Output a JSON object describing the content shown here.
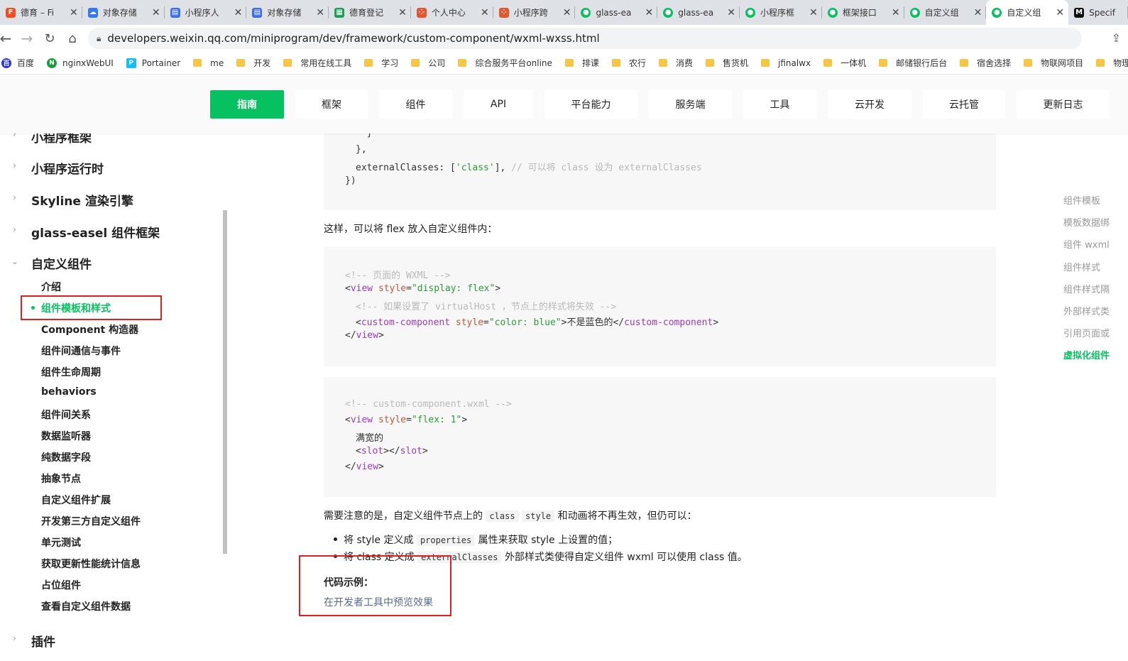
{
  "browser": {
    "tabs": [
      {
        "label": "德育 – Fi",
        "icon": "figma-icon",
        "color": "#f24e1e"
      },
      {
        "label": "对象存储",
        "icon": "cloud-icon",
        "color": "#3478f6"
      },
      {
        "label": "小程序人",
        "icon": "doc-icon",
        "color": "#3d6ee6"
      },
      {
        "label": "对象存储",
        "icon": "doc-icon",
        "color": "#3d6ee6"
      },
      {
        "label": "德育登记",
        "icon": "sheet-icon",
        "color": "#1e9e57"
      },
      {
        "label": "个人中心",
        "icon": "grid-icon",
        "color": "#e4572e"
      },
      {
        "label": "小程序跨",
        "icon": "grid-icon",
        "color": "#e4572e"
      },
      {
        "label": "glass-ea",
        "icon": "wechat-icon",
        "color": "#07c160"
      },
      {
        "label": "glass-ea",
        "icon": "wechat-icon",
        "color": "#07c160"
      },
      {
        "label": "小程序框",
        "icon": "wechat-icon",
        "color": "#07c160"
      },
      {
        "label": "框架接口",
        "icon": "wechat-icon",
        "color": "#07c160"
      },
      {
        "label": "自定义组",
        "icon": "wechat-icon",
        "color": "#07c160"
      },
      {
        "label": "自定义组",
        "icon": "wechat-icon",
        "color": "#07c160"
      },
      {
        "label": "Specif",
        "icon": "m-icon",
        "color": "#111111"
      }
    ],
    "url": "developers.weixin.qq.com/miniprogram/dev/framework/custom-component/wxml-wxss.html",
    "bookmarks": [
      {
        "label": "百度",
        "type": "icon",
        "color": "#2932e1"
      },
      {
        "label": "nginxWebUI",
        "type": "icon",
        "color": "#1a9e3c"
      },
      {
        "label": "Portainer",
        "type": "icon",
        "color": "#13bef9"
      },
      {
        "label": "me",
        "type": "folder"
      },
      {
        "label": "开发",
        "type": "folder"
      },
      {
        "label": "常用在线工具",
        "type": "folder"
      },
      {
        "label": "学习",
        "type": "folder"
      },
      {
        "label": "公司",
        "type": "folder"
      },
      {
        "label": "综合服务平台online",
        "type": "folder"
      },
      {
        "label": "排课",
        "type": "folder"
      },
      {
        "label": "农行",
        "type": "folder"
      },
      {
        "label": "消费",
        "type": "folder"
      },
      {
        "label": "售货机",
        "type": "folder"
      },
      {
        "label": "jfinalwx",
        "type": "folder"
      },
      {
        "label": "一体机",
        "type": "folder"
      },
      {
        "label": "邮储银行后台",
        "type": "folder"
      },
      {
        "label": "宿舍选择",
        "type": "folder"
      },
      {
        "label": "物联网项目",
        "type": "folder"
      },
      {
        "label": "物理系统",
        "type": "folder"
      }
    ]
  },
  "topnav": [
    "指南",
    "框架",
    "组件",
    "API",
    "平台能力",
    "服务端",
    "工具",
    "云开发",
    "云托管",
    "更新日志"
  ],
  "sidebar": {
    "sections": [
      "小程序框架",
      "小程序运行时",
      "Skyline 渲染引擎",
      "glass-easel 组件框架",
      "自定义组件",
      "插件"
    ],
    "items": [
      "介绍",
      "组件模板和样式",
      "Component 构造器",
      "组件间通信与事件",
      "组件生命周期",
      "behaviors",
      "组件间关系",
      "数据监听器",
      "纯数据字段",
      "抽象节点",
      "自定义组件扩展",
      "开发第三方自定义组件",
      "单元测试",
      "获取更新性能统计信息",
      "占位组件",
      "查看自定义组件数据"
    ]
  },
  "content": {
    "code1": {
      "line1": "  }",
      "line2": "},",
      "line3_a": "externalClasses: [",
      "line3_b": "'class'",
      "line3_c": "], ",
      "line3_d": "// 可以将 class 设为 externalClasses",
      "line4": "})"
    },
    "para1": "这样，可以将 flex 放入自定义组件内：",
    "code2": {
      "comment1": "<!-- 页面的 WXML -->",
      "view_tag": "view",
      "style_attr": "style",
      "style_val1": "\"display: flex\"",
      "comment2": "<!-- 如果设置了 virtualHost ，节点上的样式将失效 -->",
      "cc_tag": "custom-component",
      "style_val2": "\"color: blue\"",
      "cc_text": "不是蓝色的"
    },
    "code3": {
      "comment": "<!-- custom-component.wxml -->",
      "style_val": "\"flex: 1\"",
      "text": "满宽的",
      "slot_tag": "slot"
    },
    "para2_a": "需要注意的是，自定义组件节点上的",
    "para2_code1": "class",
    "para2_code2": "style",
    "para2_b": "和动画将不再生效，但仍可以：",
    "bullet1_a": "将 style 定义成",
    "bullet1_code": "properties",
    "bullet1_b": "属性来获取 style 上设置的值；",
    "bullet2_a": "将 class 定义成",
    "bullet2_code": "externalClasses",
    "bullet2_b": "外部样式类使得自定义组件 wxml 可以使用 class 值。",
    "example_title": "代码示例：",
    "example_link": "在开发者工具中预览效果"
  },
  "toc": [
    "组件模板",
    "模板数据绑",
    "组件 wxml",
    "组件样式",
    "组件样式隔",
    "外部样式类",
    "引用页面或",
    "虚拟化组件"
  ],
  "colors": {
    "accent": "#07c160",
    "highlight": "#e02020",
    "link": "#576b95"
  }
}
